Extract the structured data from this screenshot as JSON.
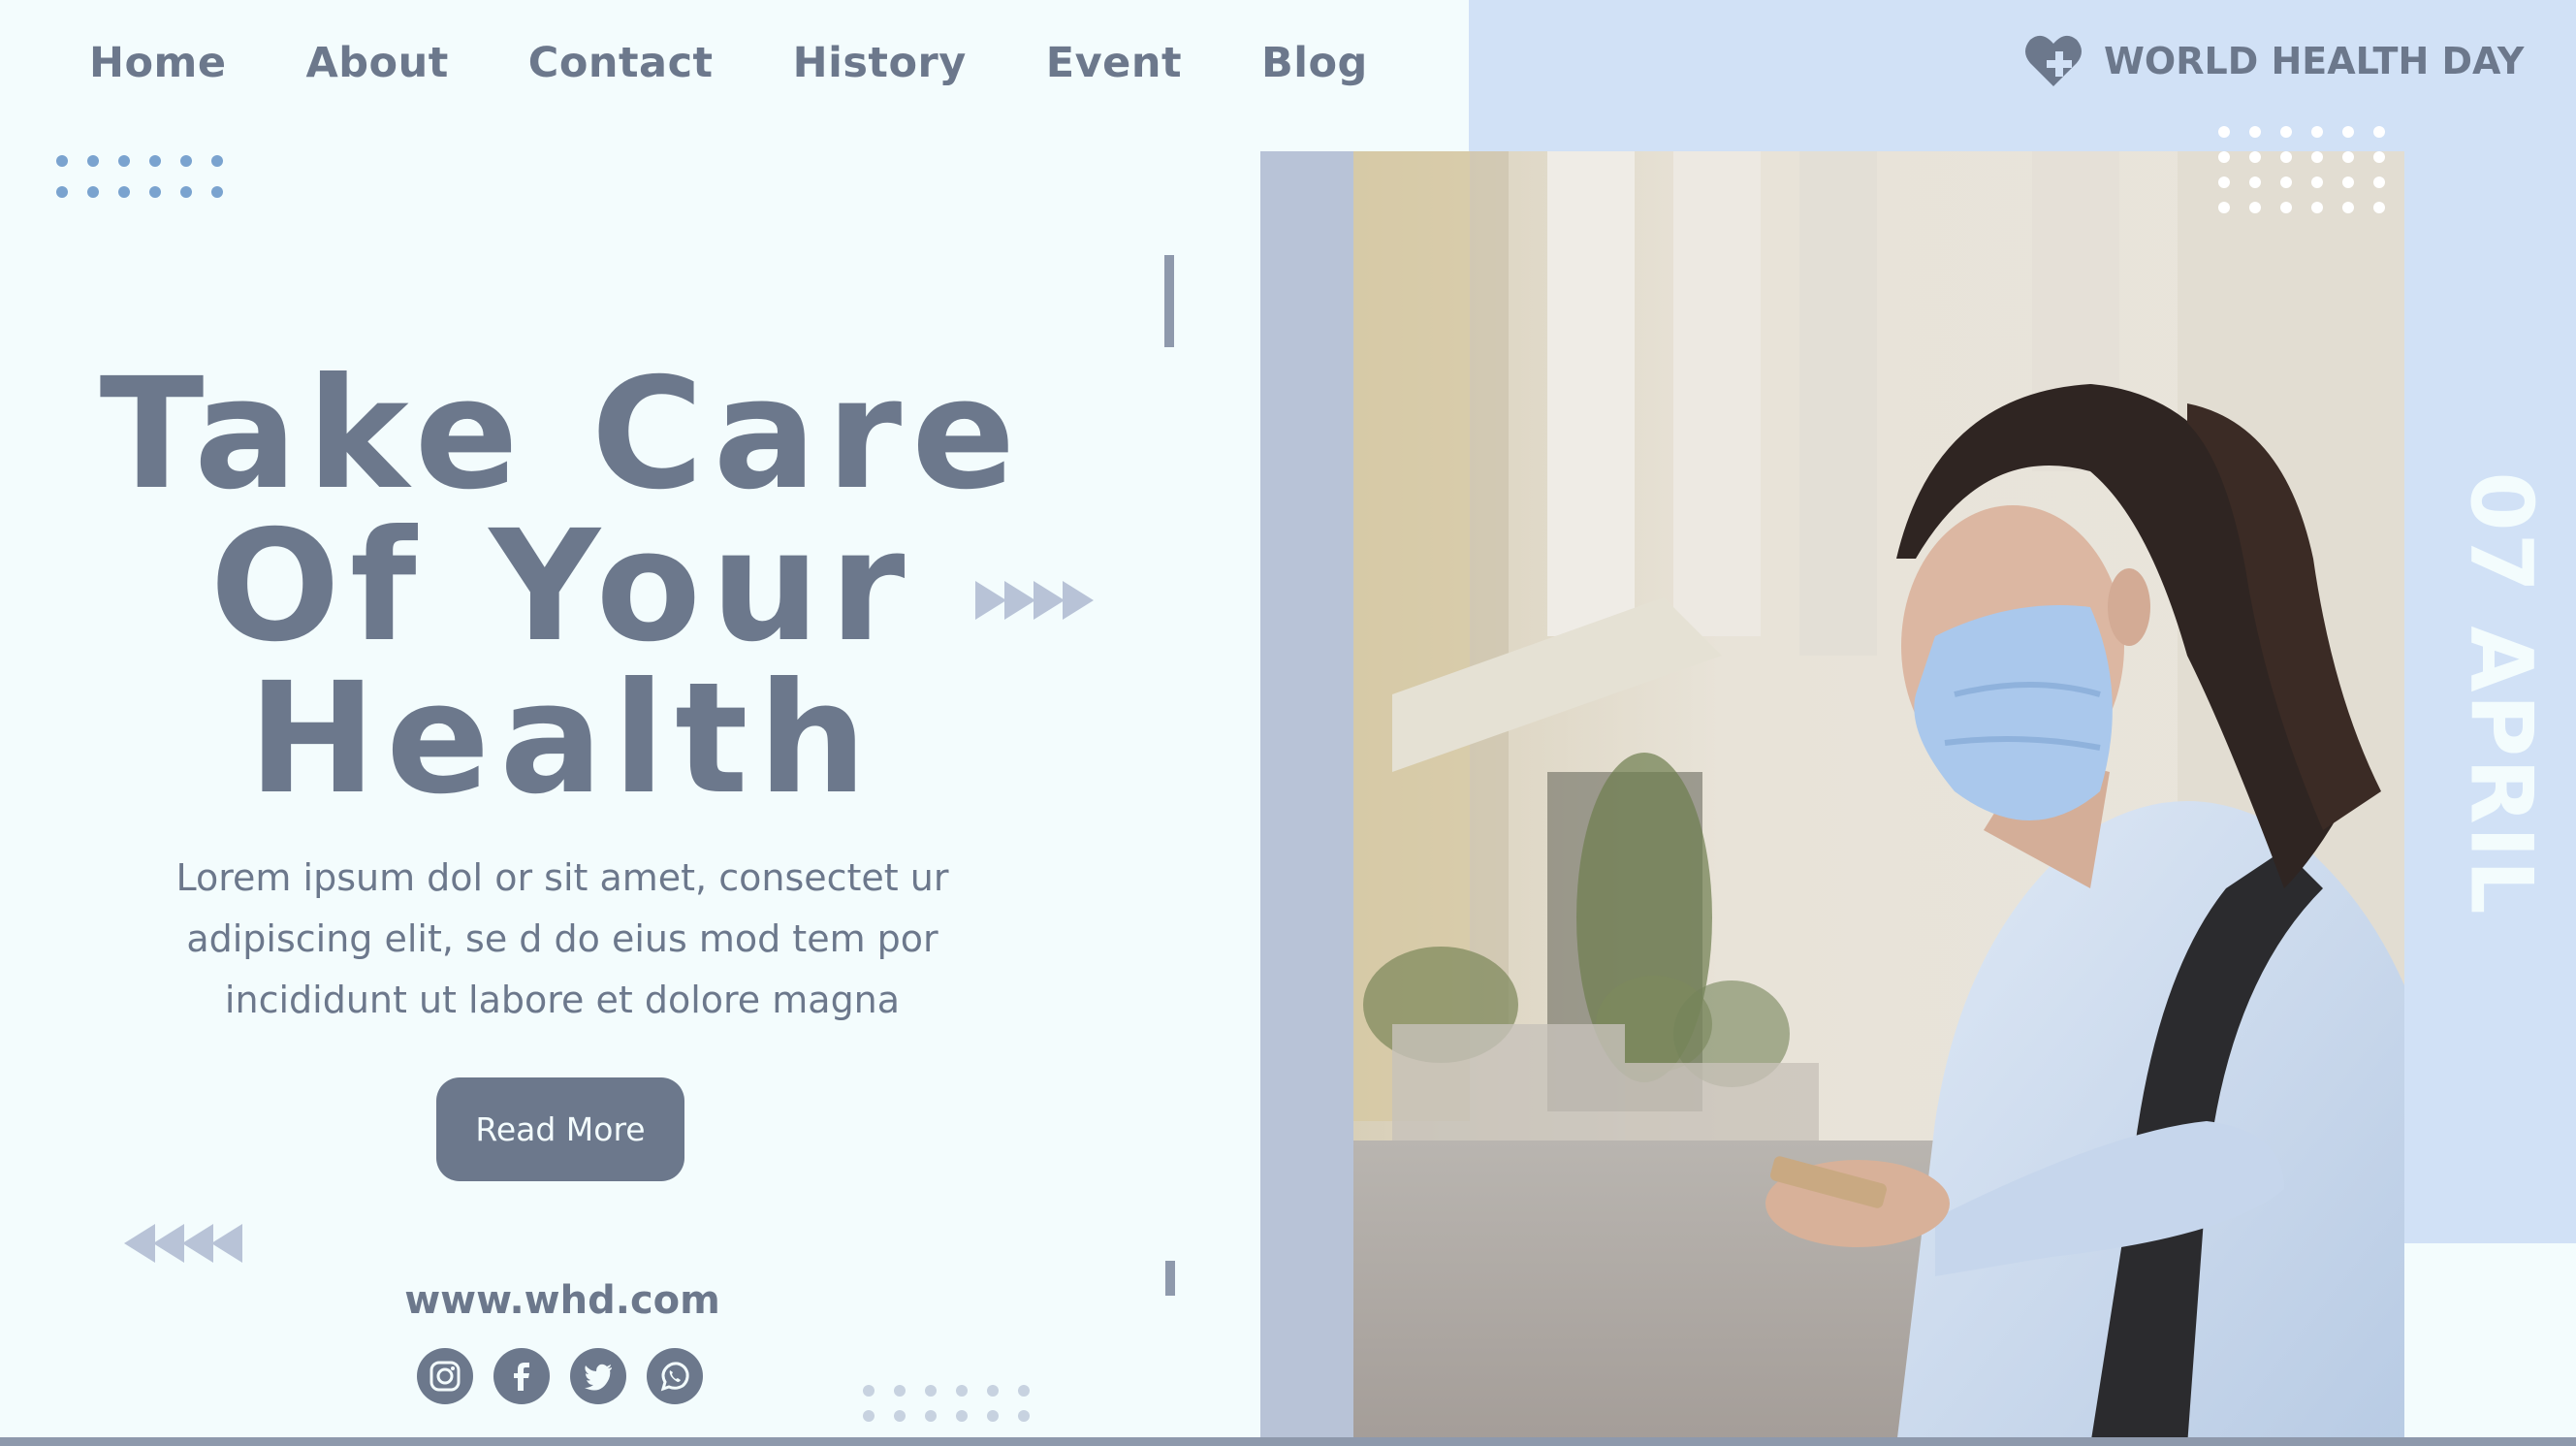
{
  "nav": {
    "items": [
      {
        "label": "Home"
      },
      {
        "label": "About"
      },
      {
        "label": "Contact"
      },
      {
        "label": "History"
      },
      {
        "label": "Event"
      },
      {
        "label": "Blog"
      }
    ]
  },
  "brand": {
    "icon": "heart-plus-icon",
    "text": "WORLD HEALTH DAY"
  },
  "hero": {
    "title_lines": [
      "Take Care",
      "Of Your",
      "Health"
    ],
    "body": "Lorem ipsum dol or sit amet, consectet ur adipiscing elit, se d do eius mod tem por incididunt ut labore et dolore magna",
    "button": "Read More"
  },
  "footer": {
    "url": "www.whd.com",
    "socials": [
      "instagram-icon",
      "facebook-icon",
      "twitter-icon",
      "whatsapp-icon"
    ]
  },
  "date_text": "07 APRIL",
  "colors": {
    "background": "#f3fcfd",
    "accent_panel": "#d1e1f6",
    "text": "#6c788c",
    "strip": "#b8c3d7",
    "dots": "#7aa3cf"
  }
}
